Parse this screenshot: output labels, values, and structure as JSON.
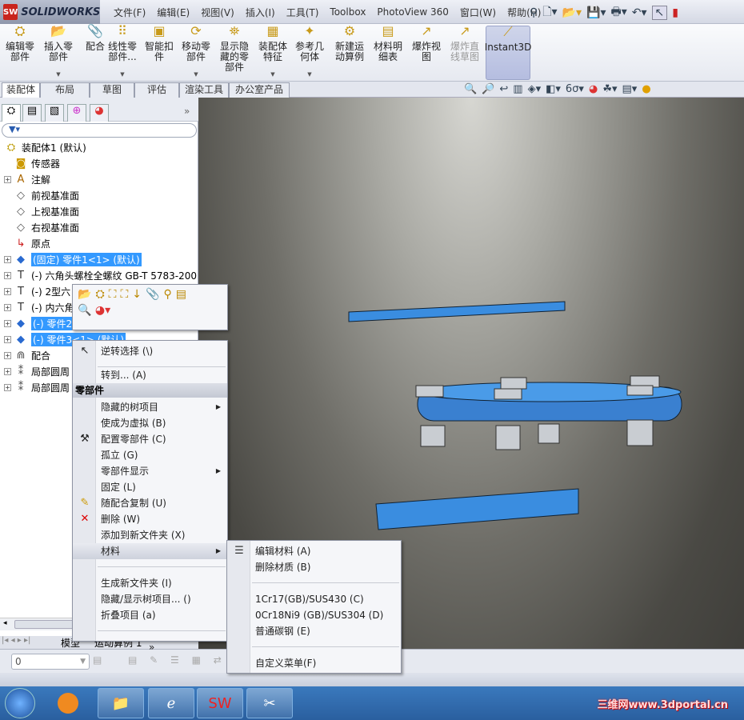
{
  "app": {
    "brand": "SOLIDWORKS",
    "logo_text": "SW"
  },
  "menus": [
    "文件(F)",
    "编辑(E)",
    "视图(V)",
    "插入(I)",
    "工具(T)",
    "Toolbox",
    "PhotoView 360",
    "窗口(W)",
    "帮助(H)"
  ],
  "command_manager": [
    {
      "label": "编辑零部件",
      "icon": "edit-component-icon",
      "dropdown": false
    },
    {
      "label": "插入零部件",
      "icon": "insert-component-icon",
      "dropdown": true
    },
    {
      "label": "配合",
      "icon": "mate-icon",
      "dropdown": false
    },
    {
      "label": "线性零部件...",
      "icon": "linear-pattern-icon",
      "dropdown": true
    },
    {
      "label": "智能扣件",
      "icon": "smart-fastener-icon",
      "dropdown": false
    },
    {
      "label": "移动零部件",
      "icon": "move-component-icon",
      "dropdown": true
    },
    {
      "label": "显示隐藏的零部件",
      "icon": "show-hidden-icon",
      "dropdown": false
    },
    {
      "label": "装配体特征",
      "icon": "assembly-feature-icon",
      "dropdown": true
    },
    {
      "label": "参考几何体",
      "icon": "reference-geometry-icon",
      "dropdown": true
    },
    {
      "label": "新建运动算例",
      "icon": "motion-study-icon",
      "dropdown": false
    },
    {
      "label": "材料明细表",
      "icon": "bom-icon",
      "dropdown": false
    },
    {
      "label": "爆炸视图",
      "icon": "explode-view-icon",
      "dropdown": false
    },
    {
      "label": "爆炸直线草图",
      "icon": "explode-line-icon",
      "dropdown": false,
      "disabled": true
    },
    {
      "label": "Instant3D",
      "icon": "instant3d-icon",
      "dropdown": false,
      "active": true
    }
  ],
  "tabs": [
    {
      "label": "装配体",
      "active": true
    },
    {
      "label": "布局"
    },
    {
      "label": "草图"
    },
    {
      "label": "评估"
    },
    {
      "label": "渲染工具"
    },
    {
      "label": "办公室产品"
    }
  ],
  "tree": {
    "items": [
      {
        "label": "装配体1  (默认)",
        "icon": "assembly-icon",
        "expand": false,
        "root": true
      },
      {
        "label": "传感器",
        "icon": "sensor-folder-icon",
        "expand": false
      },
      {
        "label": "注解",
        "icon": "annotation-icon",
        "expand": true
      },
      {
        "label": "前视基准面",
        "icon": "plane-icon",
        "expand": false
      },
      {
        "label": "上视基准面",
        "icon": "plane-icon",
        "expand": false
      },
      {
        "label": "右视基准面",
        "icon": "plane-icon",
        "expand": false
      },
      {
        "label": "原点",
        "icon": "origin-icon",
        "expand": false
      },
      {
        "label": "(固定) 零件1<1> (默认)",
        "icon": "part-icon",
        "expand": true,
        "selected": true
      },
      {
        "label": "(-) 六角头螺栓全螺纹 GB-T 5783-200",
        "icon": "bolt-icon",
        "expand": true
      },
      {
        "label": "(-) 2型六",
        "icon": "bolt-icon",
        "expand": true
      },
      {
        "label": "(-) 内六角",
        "icon": "bolt-icon",
        "expand": true
      },
      {
        "label": "(-) 零件2",
        "icon": "part-icon",
        "expand": true,
        "selected": true
      },
      {
        "label": "(-) 零件3<1> (默认)",
        "icon": "part-icon",
        "expand": true,
        "selected": true
      },
      {
        "label": "配合",
        "icon": "mates-icon",
        "expand": true
      },
      {
        "label": "局部圆周",
        "icon": "circular-pattern-icon",
        "expand": true
      },
      {
        "label": "局部圆周",
        "icon": "circular-pattern-icon",
        "expand": true
      }
    ]
  },
  "bottom_tabs": [
    "模型",
    "运动算例 1"
  ],
  "bottom_toolbar": {
    "layer_value": "0"
  },
  "context_menu": {
    "items": [
      {
        "label": "逆转选择 (\\)",
        "icon": "cursor-icon"
      },
      {
        "sep": true
      },
      {
        "label": "转到... (A)"
      },
      {
        "header": "零部件"
      },
      {
        "label": "隐藏的树项目",
        "submenu": true
      },
      {
        "label": "使成为虚拟 (B)"
      },
      {
        "label": "配置零部件 (C)",
        "icon": "configure-icon"
      },
      {
        "label": "孤立 (G)"
      },
      {
        "label": "零部件显示",
        "submenu": true
      },
      {
        "label": "固定 (L)"
      },
      {
        "label": "随配合复制 (U)",
        "icon": "copy-with-mates-icon"
      },
      {
        "label": "删除 (W)",
        "icon": "delete-icon"
      },
      {
        "label": "添加到新文件夹 (X)"
      },
      {
        "label": "材料",
        "submenu": true,
        "highlight": true
      },
      {
        "sep": true
      },
      {
        "label": "生成新文件夹 (I)"
      },
      {
        "label": "隐藏/显示树项目... ()"
      },
      {
        "label": "折叠项目 (a)"
      },
      {
        "sep": true
      },
      {
        "label": "»",
        "expand": true
      }
    ]
  },
  "material_submenu": {
    "items": [
      {
        "label": "编辑材料 (A)",
        "icon": "edit-material-icon"
      },
      {
        "label": "删除材质 (B)"
      },
      {
        "sep": true
      },
      {
        "label": "1Cr17(GB)/SUS430 (C)"
      },
      {
        "label": "0Cr18Ni9 (GB)/SUS304 (D)"
      },
      {
        "label": "普通碳钢 (E)"
      },
      {
        "sep": true
      },
      {
        "label": "自定义菜单(F)"
      }
    ]
  },
  "watermark": "三维网www.3dportal.cn",
  "colors": {
    "selection": "#3399ff",
    "part_blue": "#3a8de0"
  }
}
